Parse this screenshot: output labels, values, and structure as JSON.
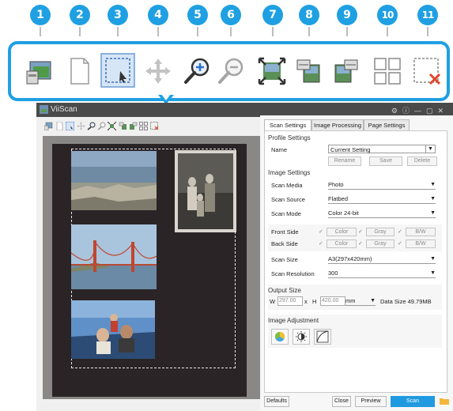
{
  "badges": [
    "1",
    "2",
    "3",
    "4",
    "5",
    "6",
    "7",
    "8",
    "9",
    "10",
    "11"
  ],
  "callout": {
    "icons": [
      "scan-to-preview-icon",
      "blank-page-icon",
      "select-area-icon",
      "pan-move-icon",
      "zoom-in-icon",
      "zoom-out-icon",
      "fit-to-window-icon",
      "rotate-left-icon",
      "rotate-right-icon",
      "multi-crop-icon",
      "clear-selection-icon"
    ]
  },
  "window": {
    "title": "ViiScan",
    "controls": [
      "⚙",
      "ⓘ",
      "—",
      "▢",
      "✕"
    ]
  },
  "tabs": [
    {
      "label": "Scan Settings",
      "active": true
    },
    {
      "label": "Image Processing",
      "active": false
    },
    {
      "label": "Page Settings",
      "active": false
    }
  ],
  "profile": {
    "section": "Profile Settings",
    "name_label": "Name",
    "name_value": "Current Setting",
    "rename": "Rename",
    "save": "Save",
    "delete": "Delete"
  },
  "image_settings": {
    "section": "Image Settings",
    "scan_media_label": "Scan Media",
    "scan_media": "Photo",
    "scan_source_label": "Scan Source",
    "scan_source": "Flatbed",
    "scan_mode_label": "Scan Mode",
    "scan_mode": "Color 24-bit",
    "front_label": "Front Side",
    "back_label": "Back Side",
    "color": "Color",
    "gray": "Gray",
    "bw": "B/W",
    "scan_size_label": "Scan Size",
    "scan_size": "A3(297x420mm)",
    "resolution_label": "Scan Resolution",
    "resolution": "300"
  },
  "output": {
    "section": "Output Size",
    "w_label": "W",
    "w": "297.00",
    "x_label": "x",
    "h_label": "H",
    "h": "420.00",
    "unit": "mm",
    "data_size": "Data Size 49.79MB"
  },
  "adjust": {
    "section": "Image Adjustment",
    "buttons": [
      "color-balance-icon",
      "brightness-contrast-icon",
      "curves-icon"
    ]
  },
  "footer": {
    "defaults": "Defaults",
    "close": "Close",
    "preview": "Preview",
    "scan": "Scan"
  },
  "colors": {
    "accent": "#1fa0e3",
    "scan_button": "#1f9ae0",
    "titlebar": "#4a4a4a"
  }
}
